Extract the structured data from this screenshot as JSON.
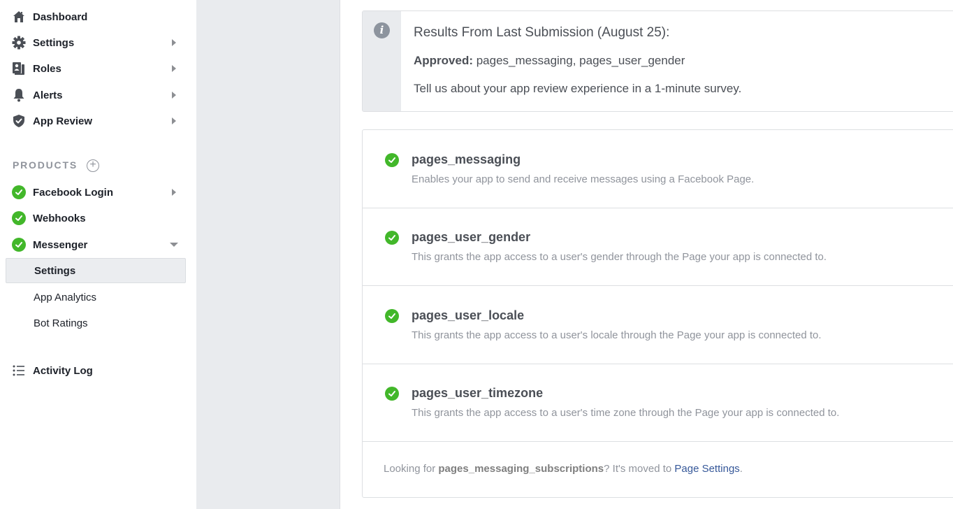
{
  "sidebar": {
    "nav": [
      {
        "label": "Dashboard",
        "icon": "home-icon",
        "has_chevron": false
      },
      {
        "label": "Settings",
        "icon": "gear-icon",
        "has_chevron": true
      },
      {
        "label": "Roles",
        "icon": "roles-icon",
        "has_chevron": true
      },
      {
        "label": "Alerts",
        "icon": "bell-icon",
        "has_chevron": true
      },
      {
        "label": "App Review",
        "icon": "shield-check-icon",
        "has_chevron": true
      }
    ],
    "products_header": "PRODUCTS",
    "add_product_symbol": "+",
    "products": [
      {
        "label": "Facebook Login",
        "status": "active",
        "expanded": false
      },
      {
        "label": "Webhooks",
        "status": "active",
        "expanded": null
      },
      {
        "label": "Messenger",
        "status": "active",
        "expanded": true
      }
    ],
    "messenger_sub": [
      {
        "label": "Settings",
        "active": true
      },
      {
        "label": "App Analytics",
        "active": false
      },
      {
        "label": "Bot Ratings",
        "active": false
      }
    ],
    "activity_log": "Activity Log"
  },
  "info_box": {
    "title": "Results From Last Submission (August 25):",
    "approved_label": "Approved:",
    "approved_value": " pages_messaging, pages_user_gender",
    "survey_text": "Tell us about your app review experience in a 1-minute survey."
  },
  "permissions": [
    {
      "name": "pages_messaging",
      "description": "Enables your app to send and receive messages using a Facebook Page.",
      "status": "approved"
    },
    {
      "name": "pages_user_gender",
      "description": "This grants the app access to a user's gender through the Page your app is connected to.",
      "status": "approved"
    },
    {
      "name": "pages_user_locale",
      "description": "This grants the app access to a user's locale through the Page your app is connected to.",
      "status": "approved"
    },
    {
      "name": "pages_user_timezone",
      "description": "This grants the app access to a user's time zone through the Page your app is connected to.",
      "status": "approved"
    }
  ],
  "footer": {
    "prefix": "Looking for ",
    "permission": "pages_messaging_subscriptions",
    "middle": "? It's moved to ",
    "link": "Page Settings",
    "suffix": "."
  },
  "colors": {
    "success_green": "#42b72a",
    "link_blue": "#365899",
    "gutter_gray": "#e9ebee"
  }
}
